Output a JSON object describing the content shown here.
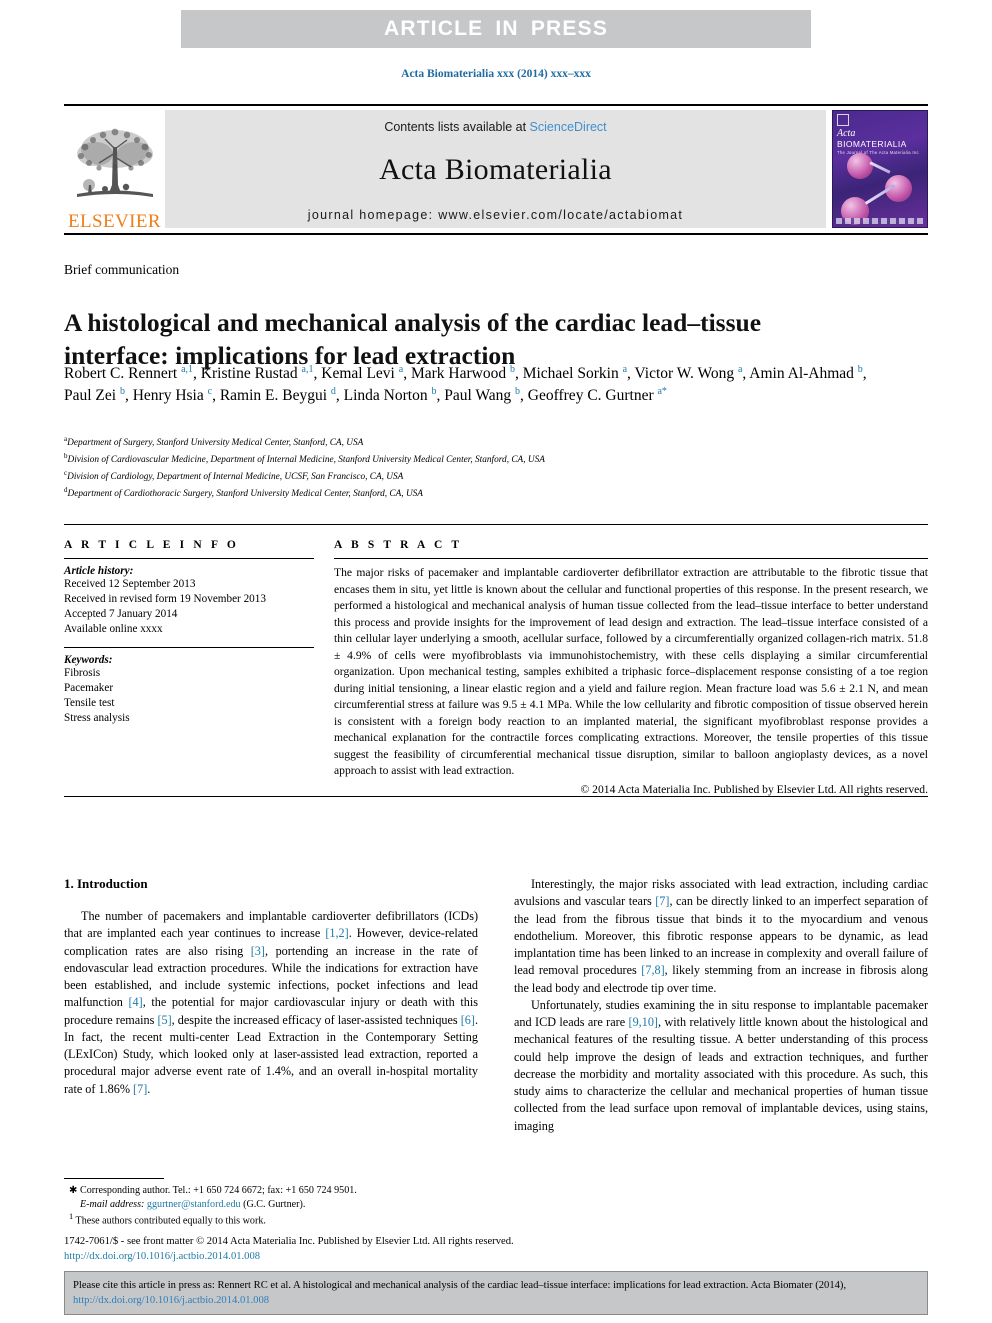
{
  "banner": {
    "text": "ARTICLE IN PRESS",
    "bg": "#c6c7c9",
    "fg": "#ffffff"
  },
  "journal_ref": "Acta Biomaterialia xxx (2014) xxx–xxx",
  "masthead": {
    "publisher": "ELSEVIER",
    "contents_prefix": "Contents lists available at ",
    "contents_link": "ScienceDirect",
    "journal_title": "Acta Biomaterialia",
    "homepage": "journal homepage: www.elsevier.com/locate/actabiomat",
    "cover": {
      "logo_word": "Acta",
      "logo_word2": "BIOMATERIALIA",
      "tagline": "The Journal of The Acta Materialia Inc"
    },
    "link_color": "#3f8fd0"
  },
  "article": {
    "type": "Brief communication",
    "title": "A histological and mechanical analysis of the cardiac lead–tissue interface: implications for lead extraction",
    "authors_html": "Robert C. Rennert <sup>a,1</sup>, Kristine Rustad <sup>a,1</sup>, Kemal Levi <sup>a</sup>, Mark Harwood <sup>b</sup>, Michael Sorkin <sup>a</sup>, Victor W. Wong <sup>a</sup>, Amin Al-Ahmad <sup>b</sup>, Paul Zei <sup>b</sup>, Henry Hsia <sup>c</sup>, Ramin E. Beygui <sup>d</sup>, Linda Norton <sup>b</sup>, Paul Wang <sup>b</sup>, Geoffrey C. Gurtner <sup>a*</sup>",
    "affiliations": [
      {
        "mark": "a",
        "text": "Department of Surgery, Stanford University Medical Center, Stanford, CA, USA"
      },
      {
        "mark": "b",
        "text": "Division of Cardiovascular Medicine, Department of Internal Medicine, Stanford University Medical Center, Stanford, CA, USA"
      },
      {
        "mark": "c",
        "text": "Division of Cardiology, Department of Internal Medicine, UCSF, San Francisco, CA, USA"
      },
      {
        "mark": "d",
        "text": "Department of Cardiothoracic Surgery, Stanford University Medical Center, Stanford, CA, USA"
      }
    ]
  },
  "article_info": {
    "heading": "A R T I C L E   I N F O",
    "history_label": "Article history:",
    "history": [
      "Received 12 September 2013",
      "Received in revised form 19 November 2013",
      "Accepted 7 January 2014",
      "Available online xxxx"
    ],
    "keywords_label": "Keywords:",
    "keywords": [
      "Fibrosis",
      "Pacemaker",
      "Tensile test",
      "Stress analysis"
    ]
  },
  "abstract": {
    "heading": "A B S T R A C T",
    "text": "The major risks of pacemaker and implantable cardioverter defibrillator extraction are attributable to the fibrotic tissue that encases them in situ, yet little is known about the cellular and functional properties of this response. In the present research, we performed a histological and mechanical analysis of human tissue collected from the lead–tissue interface to better understand this process and provide insights for the improvement of lead design and extraction. The lead–tissue interface consisted of a thin cellular layer underlying a smooth, acellular surface, followed by a circumferentially organized collagen-rich matrix. 51.8 ± 4.9% of cells were myofibroblasts via immunohistochemistry, with these cells displaying a similar circumferential organization. Upon mechanical testing, samples exhibited a triphasic force–displacement response consisting of a toe region during initial tensioning, a linear elastic region and a yield and failure region. Mean fracture load was 5.6 ± 2.1 N, and mean circumferential stress at failure was 9.5 ± 4.1 MPa. While the low cellularity and fibrotic composition of tissue observed herein is consistent with a foreign body reaction to an implanted material, the significant myofibroblast response provides a mechanical explanation for the contractile forces complicating extractions. Moreover, the tensile properties of this tissue suggest the feasibility of circumferential mechanical tissue disruption, similar to balloon angioplasty devices, as a novel approach to assist with lead extraction.",
    "copyright": "© 2014 Acta Materialia Inc. Published by Elsevier Ltd. All rights reserved."
  },
  "body": {
    "section_title": "1. Introduction",
    "left_paragraphs": [
      "The number of pacemakers and implantable cardioverter defibrillators (ICDs) that are implanted each year continues to increase [1,2]. However, device-related complication rates are also rising [3], portending an increase in the rate of endovascular lead extraction procedures. While the indications for extraction have been established, and include systemic infections, pocket infections and lead malfunction [4], the potential for major cardiovascular injury or death with this procedure remains [5], despite the increased efficacy of laser-assisted techniques [6]. In fact, the recent multi-center Lead Extraction in the Contemporary Setting (LExICon) Study, which looked only at laser-assisted lead extraction, reported a procedural major adverse event rate of 1.4%, and an overall in-hospital mortality rate of 1.86% [7]."
    ],
    "right_paragraphs": [
      "Interestingly, the major risks associated with lead extraction, including cardiac avulsions and vascular tears [7], can be directly linked to an imperfect separation of the lead from the fibrous tissue that binds it to the myocardium and venous endothelium. Moreover, this fibrotic response appears to be dynamic, as lead implantation time has been linked to an increase in complexity and overall failure of lead removal procedures [7,8], likely stemming from an increase in fibrosis along the lead body and electrode tip over time.",
      "Unfortunately, studies examining the in situ response to implantable pacemaker and ICD leads are rare [9,10], with relatively little known about the histological and mechanical features of the resulting tissue. A better understanding of this process could help improve the design of leads and extraction techniques, and further decrease the morbidity and mortality associated with this procedure. As such, this study aims to characterize the cellular and mechanical properties of human tissue collected from the lead surface upon removal of implantable devices, using stains, imaging"
    ]
  },
  "footnotes": {
    "corresponding": "Corresponding author. Tel.: +1 650 724 6672; fax: +1 650 724 9501.",
    "email_label": "E-mail address:",
    "email": "ggurtner@stanford.edu",
    "email_owner": "(G.C. Gurtner).",
    "equal_contrib": "These authors contributed equally to this work.",
    "star": "✱",
    "one": "1"
  },
  "issn_footer": {
    "line1": "1742-7061/$ - see front matter © 2014 Acta Materialia Inc. Published by Elsevier Ltd. All rights reserved.",
    "doi": "http://dx.doi.org/10.1016/j.actbio.2014.01.008"
  },
  "cite_box": {
    "text": "Please cite this article in press as: Rennert RC et al. A histological and mechanical analysis of the cardiac lead–tissue interface: implications for lead extraction. Acta Biomater (2014), ",
    "link": "http://dx.doi.org/10.1016/j.actbio.2014.01.008"
  }
}
